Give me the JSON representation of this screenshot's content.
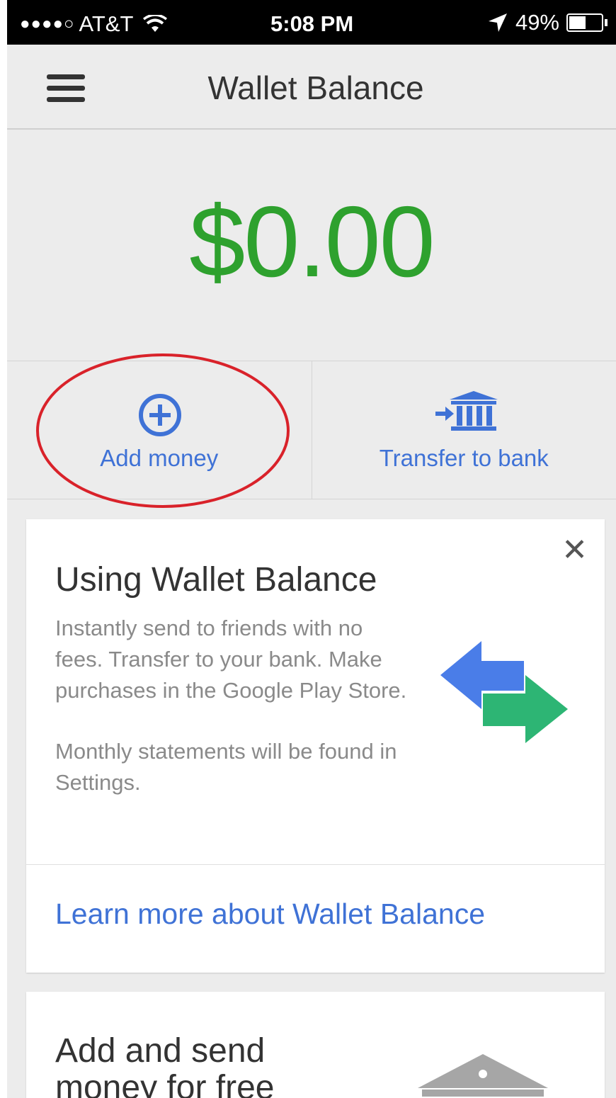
{
  "status_bar": {
    "signal_dots": "●●●●○",
    "carrier": "AT&T",
    "time": "5:08 PM",
    "battery": "49%",
    "icons": [
      "wifi-icon",
      "location-arrow-icon",
      "battery-icon"
    ]
  },
  "header": {
    "title": "Wallet Balance",
    "menu_icon": "hamburger-menu-icon"
  },
  "balance": {
    "amount": "$0.00",
    "color": "#2ea12e"
  },
  "actions": [
    {
      "label": "Add money",
      "icon": "plus-circle-icon"
    },
    {
      "label": "Transfer to bank",
      "icon": "bank-transfer-icon"
    }
  ],
  "info_card": {
    "title": "Using Wallet Balance",
    "body_1": "Instantly send to friends with no fees. Transfer to your bank. Make purchases in the Google Play Store.",
    "body_2": "Monthly statements will be found in Settings.",
    "link": "Learn more about Wallet Balance",
    "close_icon": "close-icon",
    "illustration": "exchange-arrows-icon"
  },
  "second_card": {
    "title": "Add and send money for free",
    "illustration": "bank-building-icon"
  },
  "colors": {
    "accent": "#3f72d6",
    "arrow_blue": "#4a7de8",
    "arrow_green": "#2db574",
    "highlight": "#d9222a"
  }
}
